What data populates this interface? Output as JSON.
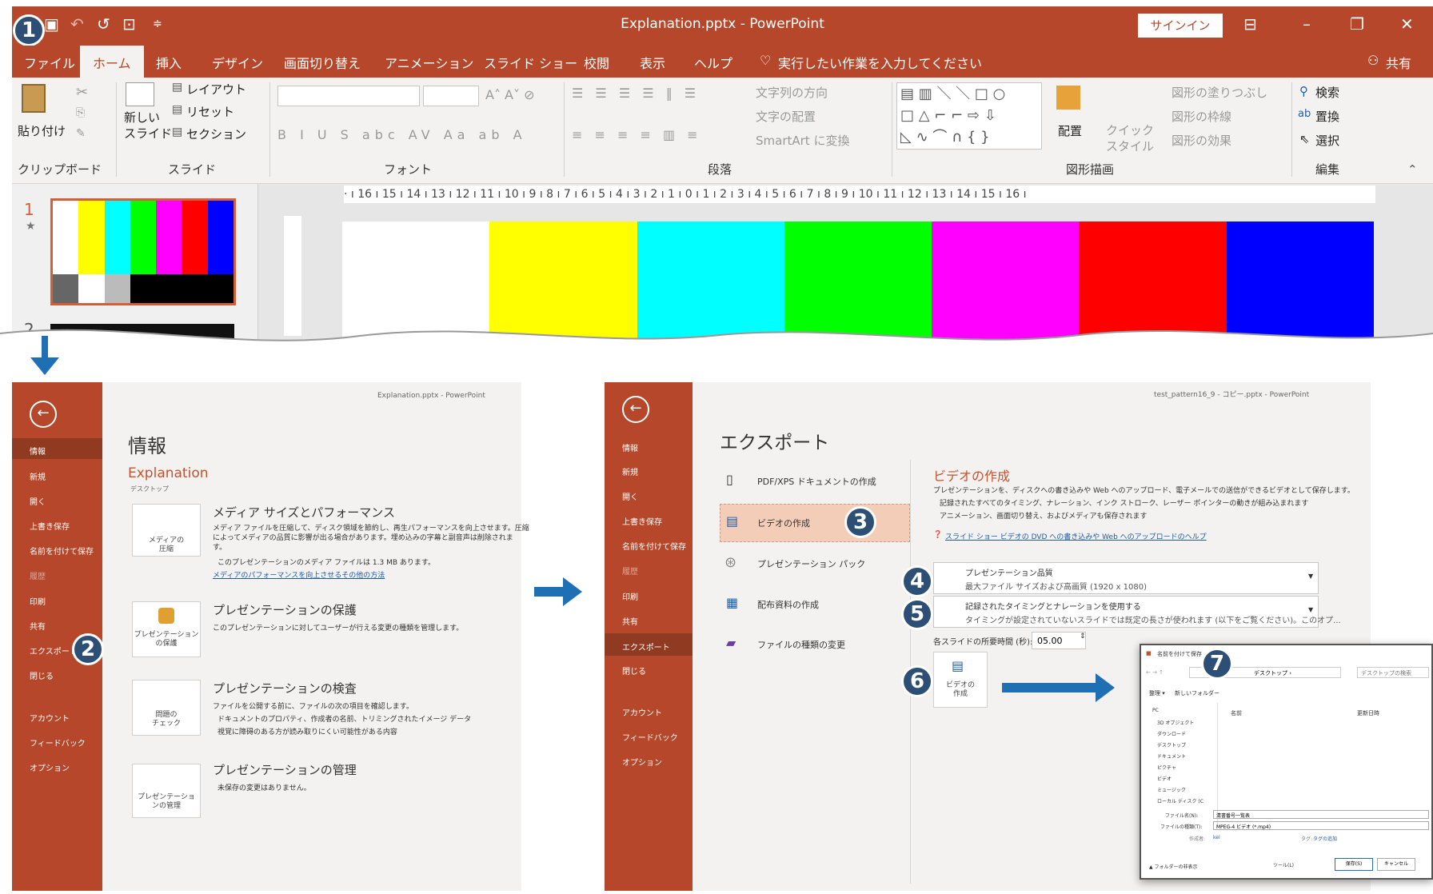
{
  "top": {
    "title": "Explanation.pptx  -  PowerPoint",
    "signin": "サインイン",
    "share": "共有",
    "tabs": [
      "ファイル",
      "ホーム",
      "挿入",
      "デザイン",
      "画面切り替え",
      "アニメーション",
      "スライド ショー",
      "校閲",
      "表示",
      "ヘルプ"
    ],
    "tellme": "実行したい作業を入力してください",
    "ribbon": {
      "paste": "貼り付け",
      "clipboard": "クリップボード",
      "new_slide": "新しい\nスライド",
      "layout": "レイアウト",
      "reset": "リセット",
      "section": "セクション",
      "slide_group": "スライド",
      "font_group": "フォント",
      "para_group": "段落",
      "text_dir": "文字列の方向",
      "text_align": "文字の配置",
      "smartart": "SmartArt に変換",
      "arrange": "配置",
      "quick": "クイック\nスタイル",
      "fill": "図形の塗りつぶし",
      "outline": "図形の枠線",
      "effect": "図形の効果",
      "draw_group": "図形描画",
      "find": "検索",
      "replace": "置換",
      "select": "選択",
      "edit_group": "編集"
    },
    "ruler": "· ı 16 ı 15 ı 14 ı 13 ı 12 ı 11 ı 10 ı 9 ı 8 ı 7 ı 6 ı 5 ı 4 ı 3 ı 2 ı 1 ı 0 ı 1 ı 2 ı 3 ı 4 ı 5 ı 6 ı 7 ı 8 ı 9 ı 10 ı 11 ı 12 ı 13 ı 14 ı 15 ı 16 ı",
    "slide1": "1",
    "slide2": "2"
  },
  "bars": [
    "#ffffff",
    "#ffff00",
    "#00ffff",
    "#00ff00",
    "#ff00ff",
    "#ff0000",
    "#0000ff"
  ],
  "info": {
    "header": "Explanation.pptx - PowerPoint",
    "title": "情報",
    "filename": "Explanation",
    "location": "デスクトップ",
    "nav": [
      "情報",
      "新規",
      "開く",
      "上書き保存",
      "名前を付けて保存",
      "履歴",
      "印刷",
      "共有",
      "エクスポート",
      "閉じる",
      "アカウント",
      "フィードバック",
      "オプション"
    ],
    "s1": {
      "h": "メディア サイズとパフォーマンス",
      "d": "メディア ファイルを圧縮して、ディスク領域を節約し、再生パフォーマンスを向上させます。圧縮\nによってメディアの品質に影響が出る場合があります。埋め込みの字幕と副音声は削除されま\nす。",
      "b": "このプレゼンテーションのメディア ファイルは 1.3 MB あります。",
      "l": "メディアのパフォーマンスを向上させるその他の方法",
      "btn": "メディアの\n圧縮"
    },
    "s2": {
      "h": "プレゼンテーションの保護",
      "d": "このプレゼンテーションに対してユーザーが行える変更の種類を管理します。",
      "btn": "プレゼンテーション\nの保護"
    },
    "s3": {
      "h": "プレゼンテーションの検査",
      "d": "ファイルを公開する前に、ファイルの次の項目を確認します。",
      "b1": "ドキュメントのプロパティ、作成者の名前、トリミングされたイメージ データ",
      "b2": "視覚に障碍のある方が読み取りにくい可能性がある内容",
      "btn": "問題の\nチェック"
    },
    "s4": {
      "h": "プレゼンテーションの管理",
      "d": "未保存の変更はありません。",
      "btn": "プレゼンテーショ\nンの管理"
    }
  },
  "export": {
    "header": "test_pattern16_9 - コピー.pptx - PowerPoint",
    "title": "エクスポート",
    "nav": [
      "情報",
      "新規",
      "開く",
      "上書き保存",
      "名前を付けて保存",
      "履歴",
      "印刷",
      "共有",
      "エクスポート",
      "閉じる",
      "アカウント",
      "フィードバック",
      "オプション"
    ],
    "options": [
      "PDF/XPS ドキュメントの作成",
      "ビデオの作成",
      "プレゼンテーション パック",
      "配布資料の作成",
      "ファイルの種類の変更"
    ],
    "video": {
      "h": "ビデオの作成",
      "d": "プレゼンテーションを、ディスクへの書き込みや Web へのアップロード、電子メールでの送信ができるビデオとして保存します。",
      "b1": "記録されたすべてのタイミング、ナレーション、インク ストローク、レーザー ポインターの動きが組み込まれます",
      "b2": "アニメーション、画面切り替え、およびメディアも保存されます",
      "help": "スライド ショー ビデオの DVD への書き込みや Web へのアップロードのヘルプ",
      "q_t": "プレゼンテーション品質",
      "q_s": "最大ファイル サイズおよび高画質 (1920 x 1080)",
      "t_t": "記録されたタイミングとナレーションを使用する",
      "t_s": "タイミングが設定されていないスライドでは既定の長さが使われます (以下をご覧ください)。このオプ...",
      "sec_l": "各スライドの所要時間 (秒):",
      "sec_v": "05.00",
      "btn": "ビデオの\n作成"
    }
  },
  "dialog": {
    "title": "名前を付けて保存",
    "path": "デスクトップ ›",
    "search": "デスクトップの検索",
    "tb1": "整理 ▾",
    "tb2": "新しいフォルダー",
    "col1": "名前",
    "col2": "更新日時",
    "tree": [
      "PC",
      "3D オブジェクト",
      "ダウンロード",
      "デスクトップ",
      "ドキュメント",
      "ピクチャ",
      "ビデオ",
      "ミュージック",
      "ローカル ディスク (C"
    ],
    "fn_l": "ファイル名(N):",
    "fn_v": "清書番号一覧表",
    "ft_l": "ファイルの種類(T):",
    "ft_v": "MPEG-4 ビデオ (*.mp4)",
    "au_l": "作成者:",
    "au_v": "kei",
    "tag_l": "タグ:",
    "tag_v": "タグの追加",
    "hide": "▲ フォルダーの非表示",
    "tools": "ツール(L)",
    "save": "保存(S)",
    "cancel": "キャンセル"
  },
  "badges": [
    "1",
    "2",
    "3",
    "4",
    "5",
    "6",
    "7"
  ]
}
